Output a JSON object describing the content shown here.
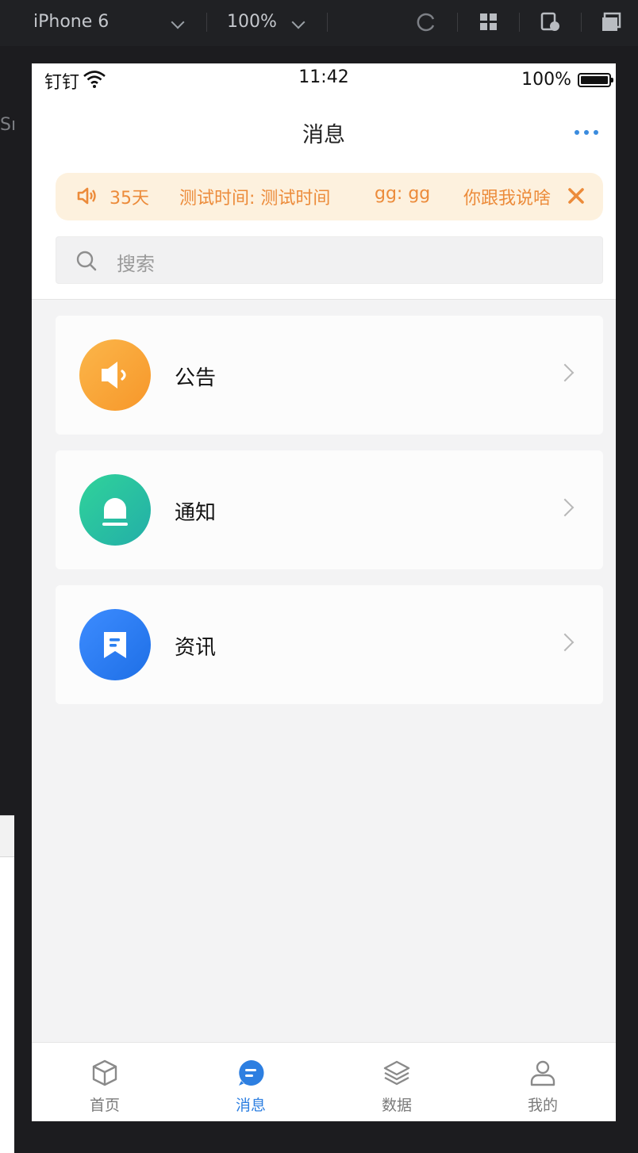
{
  "devtools": {
    "device": "iPhone 6",
    "zoom": "100%"
  },
  "side": {
    "label": "Sı"
  },
  "status_bar": {
    "carrier": "钉钉",
    "time": "11:42",
    "battery_pct": "100%"
  },
  "nav": {
    "title": "消息"
  },
  "notice": {
    "items": [
      "35天",
      "测试时间: 测试时间",
      "gg: gg",
      "你跟我说啥"
    ],
    "color": "#ec8b3a"
  },
  "search": {
    "placeholder": "搜索"
  },
  "cards": [
    {
      "label": "公告",
      "icon": "megaphone-icon",
      "color": "#f9a53a"
    },
    {
      "label": "通知",
      "icon": "bell-icon",
      "color": "#2bc19a"
    },
    {
      "label": "资讯",
      "icon": "bookmark-note-icon",
      "color": "#2a7ff0"
    }
  ],
  "tabbar": {
    "tabs": [
      {
        "label": "首页",
        "icon": "cube-icon",
        "active": false
      },
      {
        "label": "消息",
        "icon": "chat-bubble-icon",
        "active": true
      },
      {
        "label": "数据",
        "icon": "layers-icon",
        "active": false
      },
      {
        "label": "我的",
        "icon": "user-icon",
        "active": false
      }
    ],
    "active_color": "#2d7fe1"
  }
}
